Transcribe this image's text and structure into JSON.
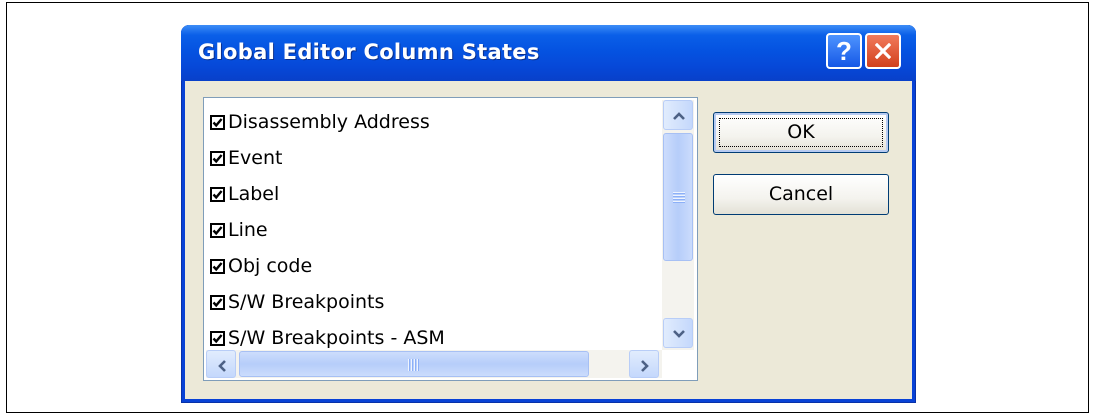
{
  "dialog": {
    "title": "Global Editor Column States",
    "help_glyph": "?",
    "ok_label": "OK",
    "cancel_label": "Cancel"
  },
  "columns": [
    {
      "label": "Disassembly Address",
      "checked": true
    },
    {
      "label": "Event",
      "checked": true
    },
    {
      "label": "Label",
      "checked": true
    },
    {
      "label": "Line",
      "checked": true
    },
    {
      "label": "Obj code",
      "checked": true
    },
    {
      "label": "S/W Breakpoints",
      "checked": true
    },
    {
      "label": "S/W Breakpoints - ASM",
      "checked": true
    }
  ],
  "colors": {
    "titlebar": "#0553e1",
    "client": "#ece9d8",
    "close": "#d1401c"
  }
}
